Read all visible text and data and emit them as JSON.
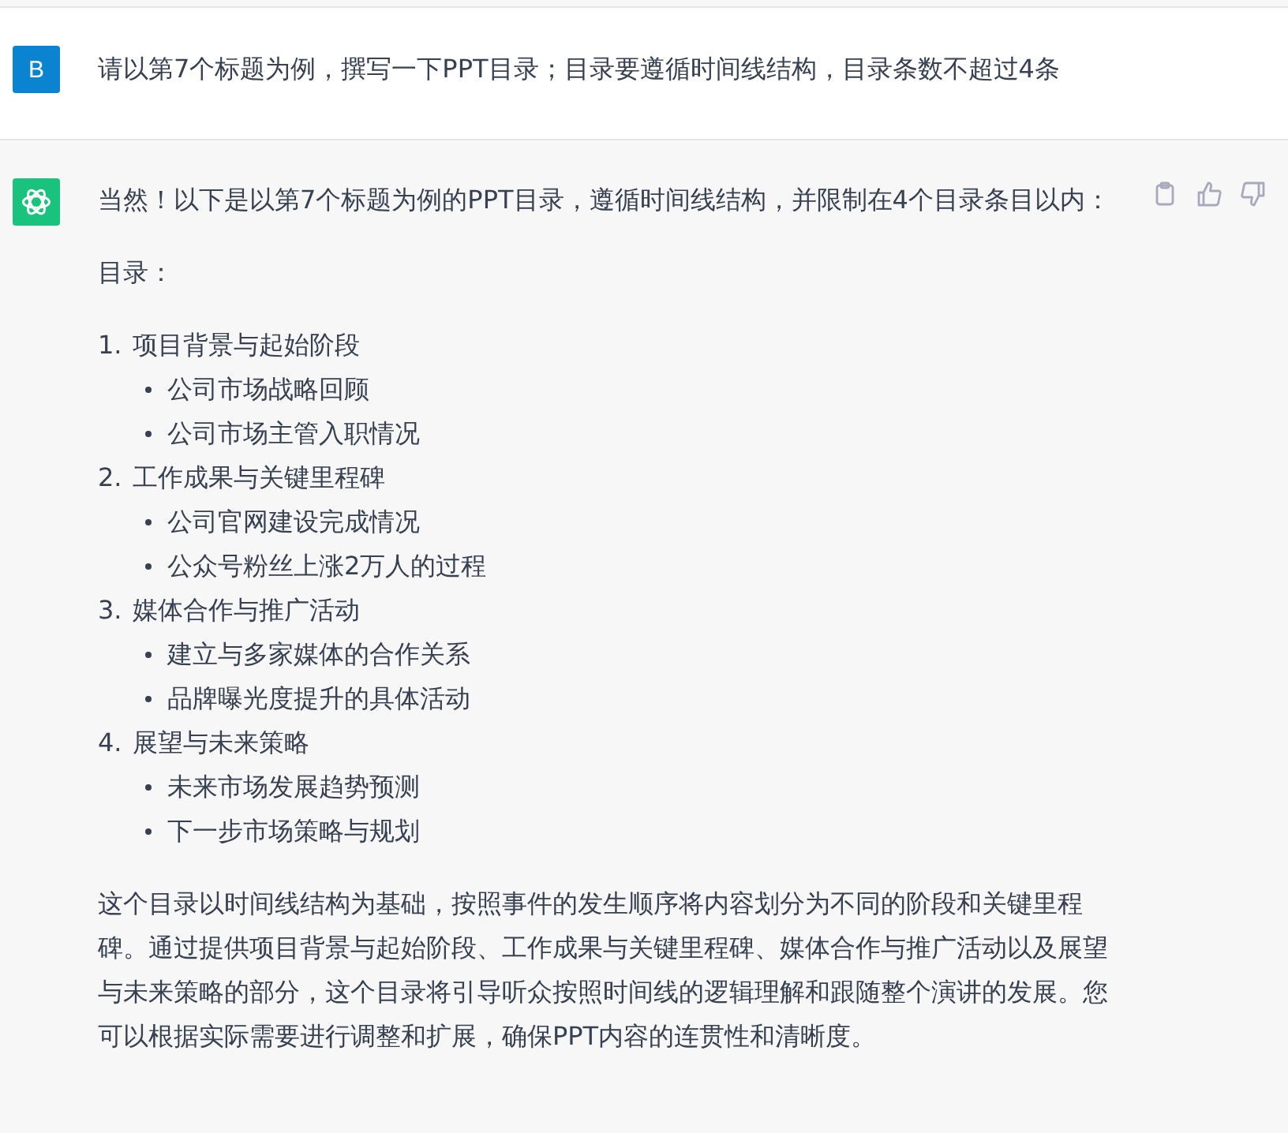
{
  "user_message": {
    "avatar_letter": "B",
    "text": "请以第7个标题为例，撰写一下PPT目录；目录要遵循时间线结构，目录条数不超过4条"
  },
  "assistant_message": {
    "intro": "当然！以下是以第7个标题为例的PPT目录，遵循时间线结构，并限制在4个目录条目以内：",
    "heading": "目录：",
    "toc": [
      {
        "number": "1.",
        "title": "项目背景与起始阶段",
        "children": [
          "公司市场战略回顾",
          "公司市场主管入职情况"
        ]
      },
      {
        "number": "2.",
        "title": "工作成果与关键里程碑",
        "children": [
          "公司官网建设完成情况",
          "公众号粉丝上涨2万人的过程"
        ]
      },
      {
        "number": "3.",
        "title": "媒体合作与推广活动",
        "children": [
          "建立与多家媒体的合作关系",
          "品牌曝光度提升的具体活动"
        ]
      },
      {
        "number": "4.",
        "title": "展望与未来策略",
        "children": [
          "未来市场发展趋势预测",
          "下一步市场策略与规划"
        ]
      }
    ],
    "conclusion": "这个目录以时间线结构为基础，按照事件的发生顺序将内容划分为不同的阶段和关键里程碑。通过提供项目背景与起始阶段、工作成果与关键里程碑、媒体合作与推广活动以及展望与未来策略的部分，这个目录将引导听众按照时间线的逻辑理解和跟随整个演讲的发展。您可以根据实际需要进行调整和扩展，确保PPT内容的连贯性和清晰度。"
  }
}
